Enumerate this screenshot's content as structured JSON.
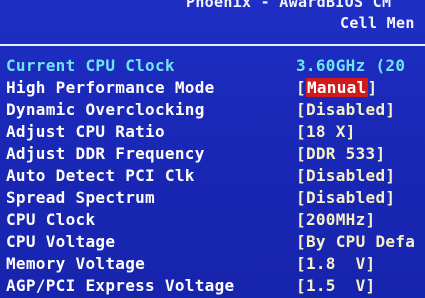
{
  "header": {
    "title_line1": "Phoenix - AwardBIOS CM",
    "title_line2": "Cell Men"
  },
  "rows": [
    {
      "label": "Current CPU Clock",
      "value": "3.60GHz (20",
      "kind": "info"
    },
    {
      "label": "High Performance Mode",
      "value": "Manual",
      "kind": "option",
      "selected": true
    },
    {
      "label": "Dynamic Overclocking",
      "value": "Disabled",
      "kind": "option"
    },
    {
      "label": "Adjust CPU Ratio",
      "value": "18 X",
      "kind": "option"
    },
    {
      "label": "Adjust DDR Frequency",
      "value": "DDR 533",
      "kind": "option"
    },
    {
      "label": "Auto Detect PCI Clk",
      "value": "Disabled",
      "kind": "option"
    },
    {
      "label": "Spread Spectrum",
      "value": "Disabled",
      "kind": "option"
    },
    {
      "label": "CPU Clock",
      "value": "200MHz",
      "kind": "option"
    },
    {
      "label": "CPU Voltage",
      "value": "By CPU Defa",
      "kind": "option",
      "truncated": true
    },
    {
      "label": "Memory Voltage",
      "value": "1.8  V",
      "kind": "option"
    },
    {
      "label": "AGP/PCI Express Voltage",
      "value": "1.5  V",
      "kind": "option"
    }
  ],
  "colors": {
    "background": "#1a28b8",
    "label": "#ffffff",
    "value": "#f6f2c8",
    "info": "#6fe4f2",
    "selection": "#d11a1a"
  }
}
